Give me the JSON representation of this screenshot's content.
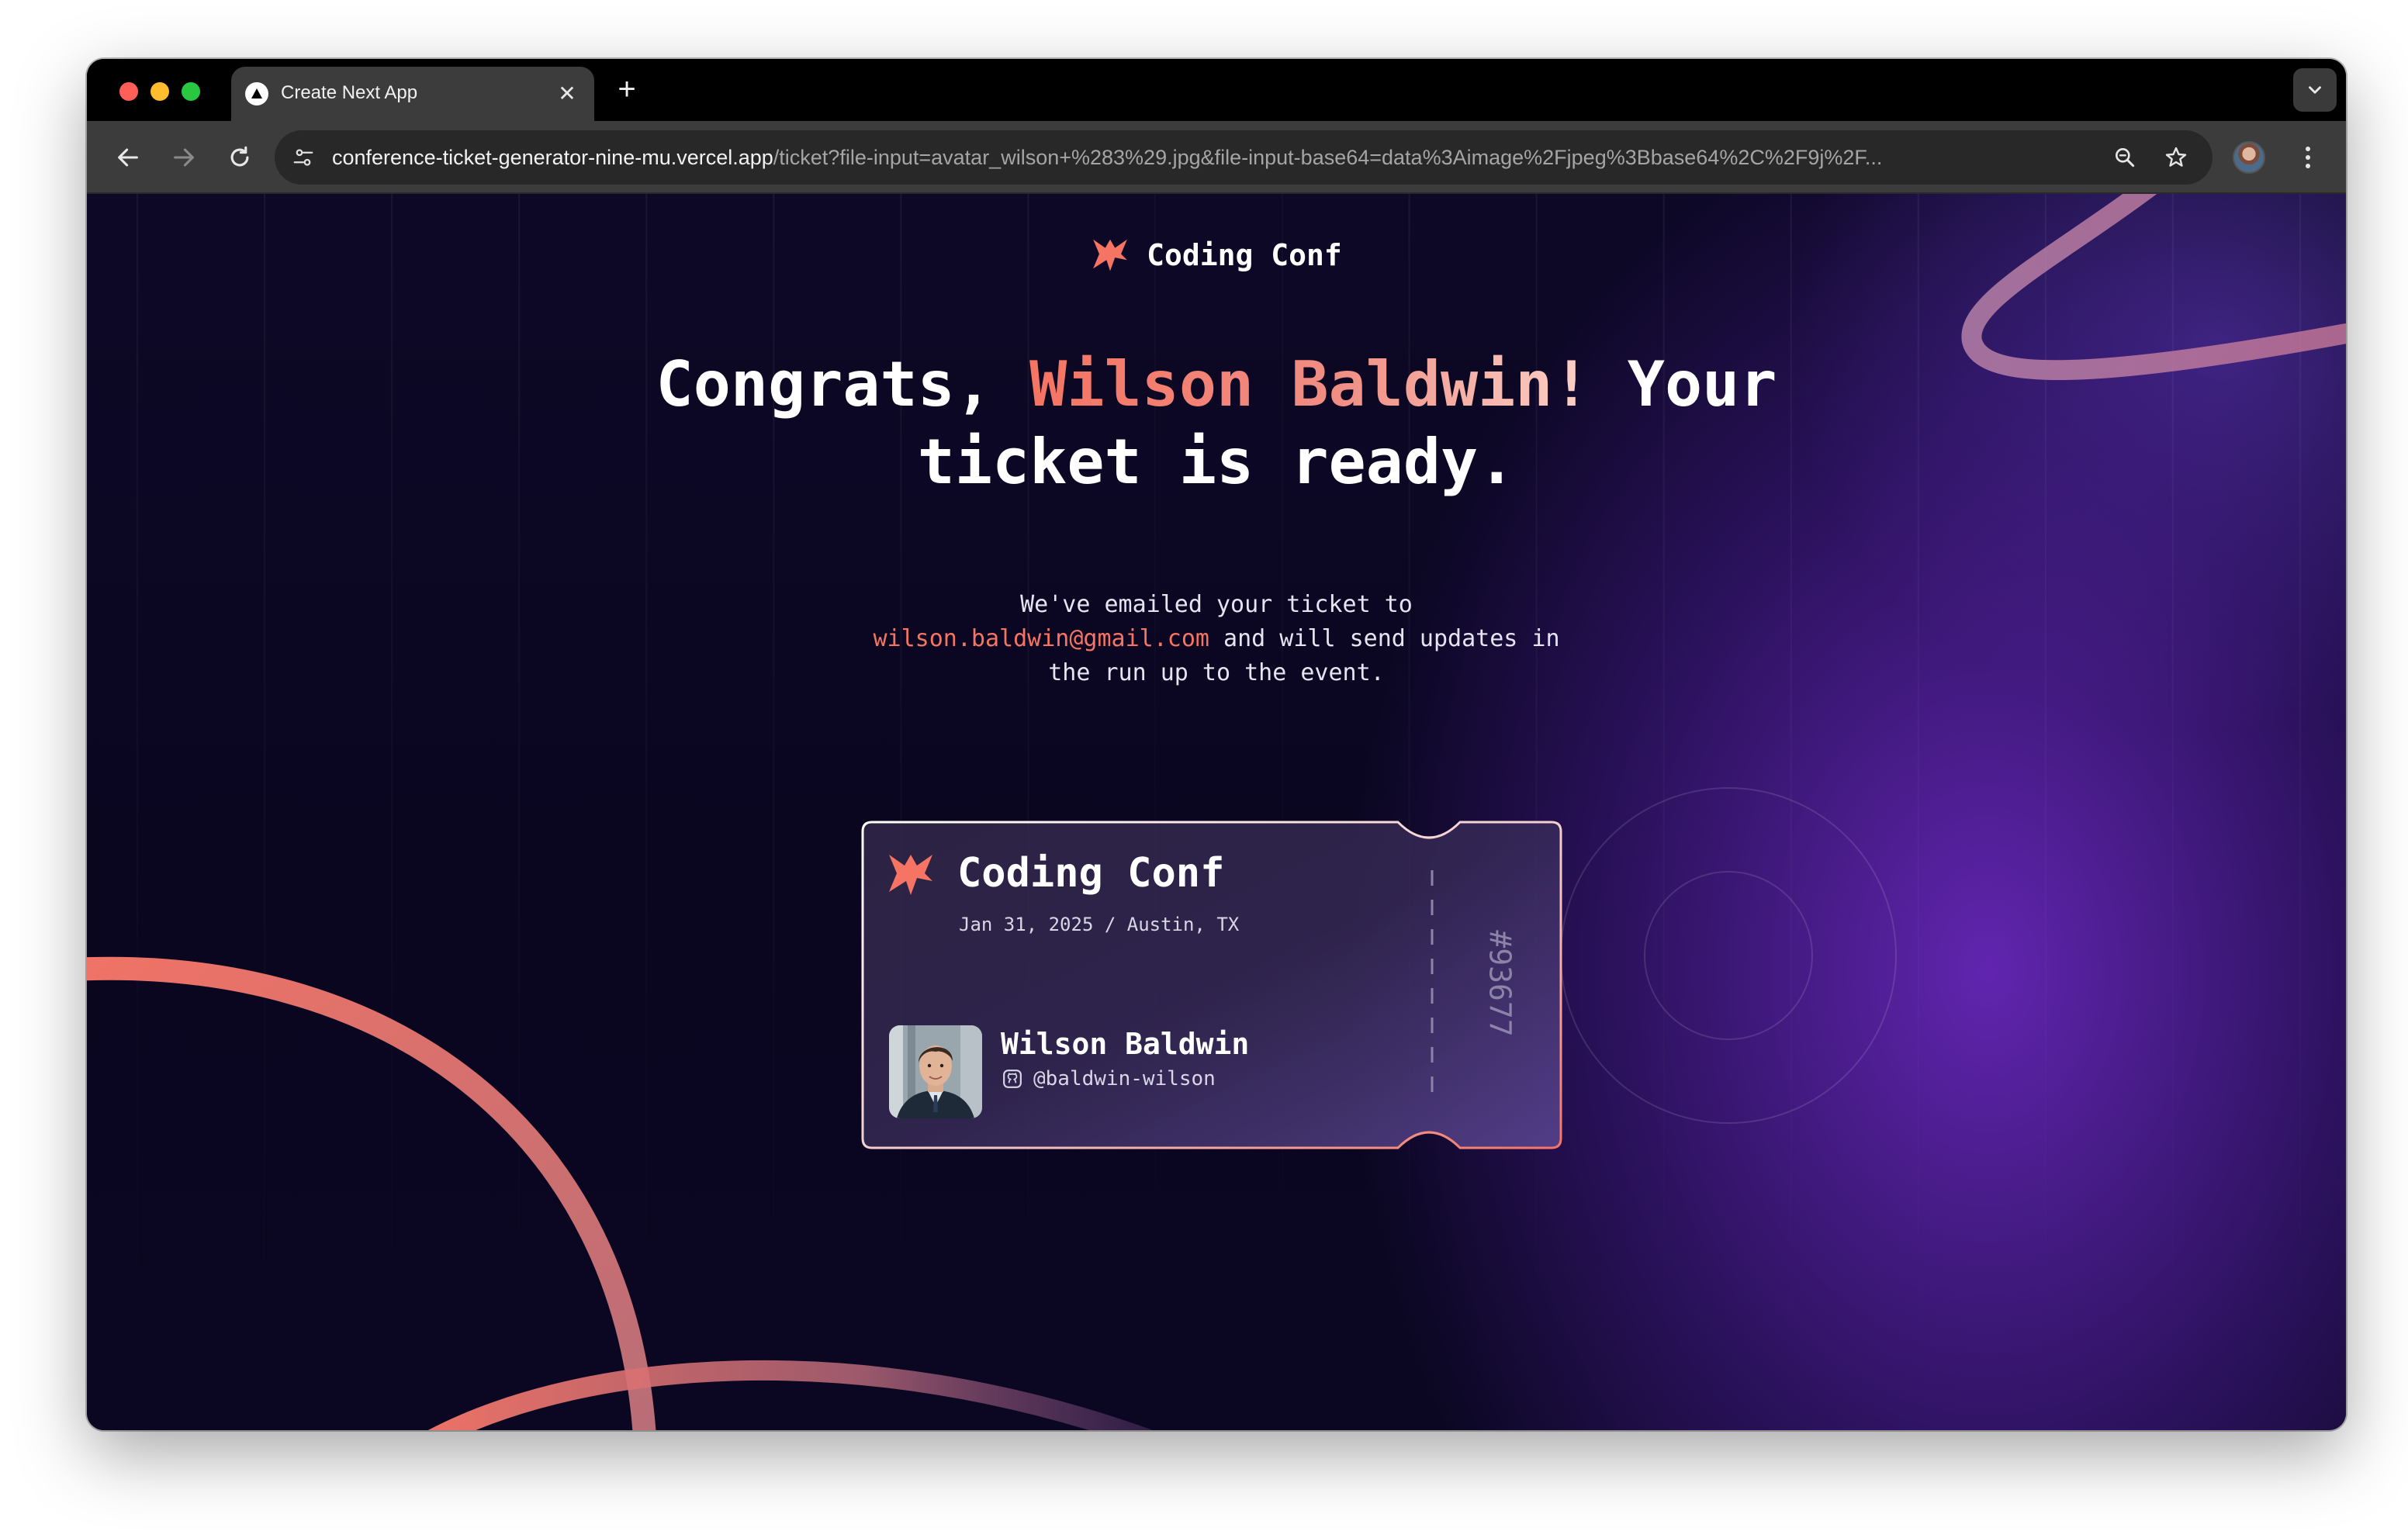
{
  "browser": {
    "tab_title": "Create Next App",
    "tab_close": "✕",
    "new_tab": "+",
    "url_host": "conference-ticket-generator-nine-mu.vercel.app",
    "url_path": "/ticket?file-input=avatar_wilson+%283%29.jpg&file-input-base64=data%3Aimage%2Fjpeg%3Bbase64%2C%2F9j%2F..."
  },
  "header": {
    "brand_name": "Coding Conf"
  },
  "hero": {
    "line_prefix": "Congrats, ",
    "name": "Wilson Baldwin!",
    "line_suffix": " Your ticket is ready."
  },
  "message": {
    "before_email": "We've emailed your ticket to ",
    "email": "wilson.baldwin@gmail.com",
    "after_email": " and will send updates in the run up to the event."
  },
  "ticket": {
    "event_name": "Coding Conf",
    "meta": "Jan 31, 2025 / Austin, TX",
    "attendee_name": "Wilson Baldwin",
    "github_handle": "@baldwin-wilson",
    "ticket_number": "#93677"
  },
  "colors": {
    "accent": "#f57463",
    "accent_light": "#fbd2c8",
    "background": "#0d0826",
    "purple_glow": "#702ac8"
  },
  "icons": {
    "brand": "coding-conf-logo-icon",
    "github": "github-icon",
    "back": "arrow-left-icon",
    "forward": "arrow-right-icon",
    "reload": "reload-icon",
    "site_settings": "tune-icon",
    "zoom": "magnifier-icon",
    "bookmark": "star-icon",
    "menu": "kebab-icon"
  }
}
